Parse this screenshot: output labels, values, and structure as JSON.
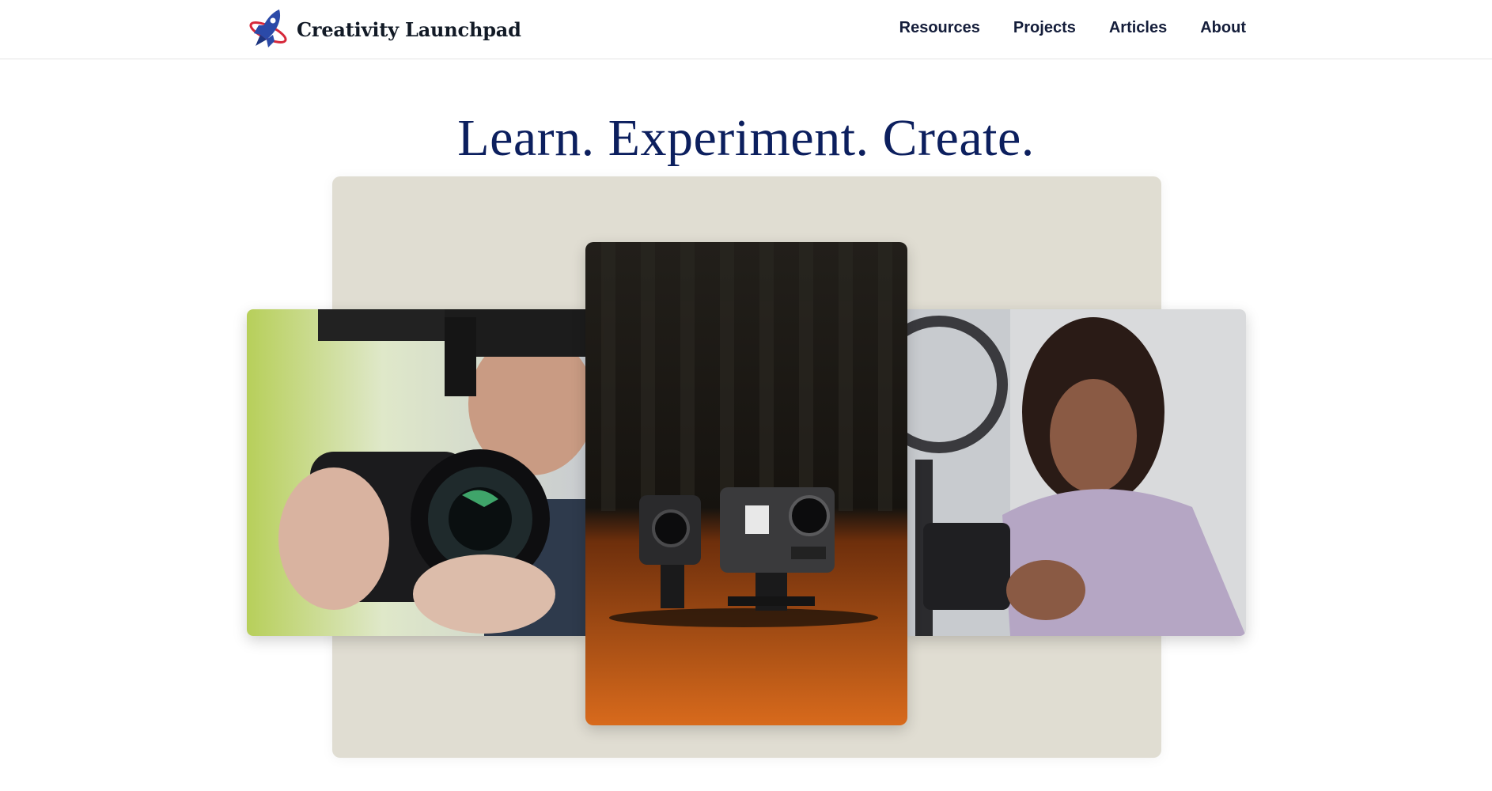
{
  "header": {
    "brand_name": "Creativity Launchpad",
    "logo_icon": "rocket-icon",
    "nav": [
      {
        "label": "Resources"
      },
      {
        "label": "Projects"
      },
      {
        "label": "Articles"
      },
      {
        "label": "About"
      }
    ]
  },
  "hero": {
    "title": "Learn. Experiment. Create."
  },
  "colors": {
    "title": "#0c1f5e",
    "nav_text": "#141d3a",
    "stage_bg": "#e0ddd2",
    "logo_blue": "#2b4aa8",
    "logo_red": "#d6283a"
  }
}
